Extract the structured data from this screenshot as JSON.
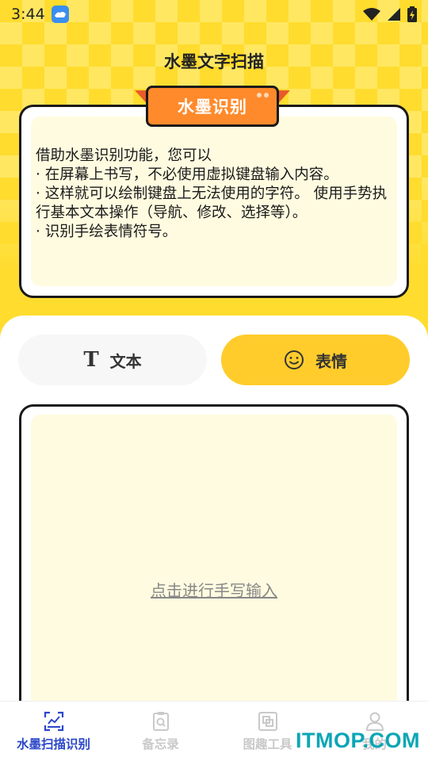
{
  "status_bar": {
    "time": "3:44"
  },
  "header": {
    "title": "水墨文字扫描"
  },
  "card": {
    "badge": "水墨识别",
    "lines": [
      "借助水墨识别功能，您可以",
      " · 在屏幕上书写，不必使用虚拟键盘输入内容。",
      " · 这样就可以绘制键盘上无法使用的字符。 使用手势执行基本文本操作（导航、修改、选择等）。",
      " · 识别手绘表情符号。"
    ]
  },
  "tabs": [
    {
      "label": "文本",
      "icon": "text-T-icon",
      "selected": false
    },
    {
      "label": "表情",
      "icon": "smiley-icon",
      "selected": true
    }
  ],
  "writing_area": {
    "hint": "点击进行手写输入"
  },
  "bottom_nav": {
    "items": [
      {
        "label": "水墨扫描识别",
        "icon": "scan-icon",
        "active": true
      },
      {
        "label": "备忘录",
        "icon": "memo-icon",
        "active": false
      },
      {
        "label": "图趣工具",
        "icon": "tools-icon",
        "active": false
      },
      {
        "label": "我的",
        "icon": "profile-icon",
        "active": false
      }
    ]
  },
  "watermark": "ITMOP.COM",
  "colors": {
    "accent_yellow": "#ffdc2e",
    "badge_orange": "#ff8a2b",
    "nav_active": "#2b47c9",
    "watermark": "#0aa6b6"
  }
}
